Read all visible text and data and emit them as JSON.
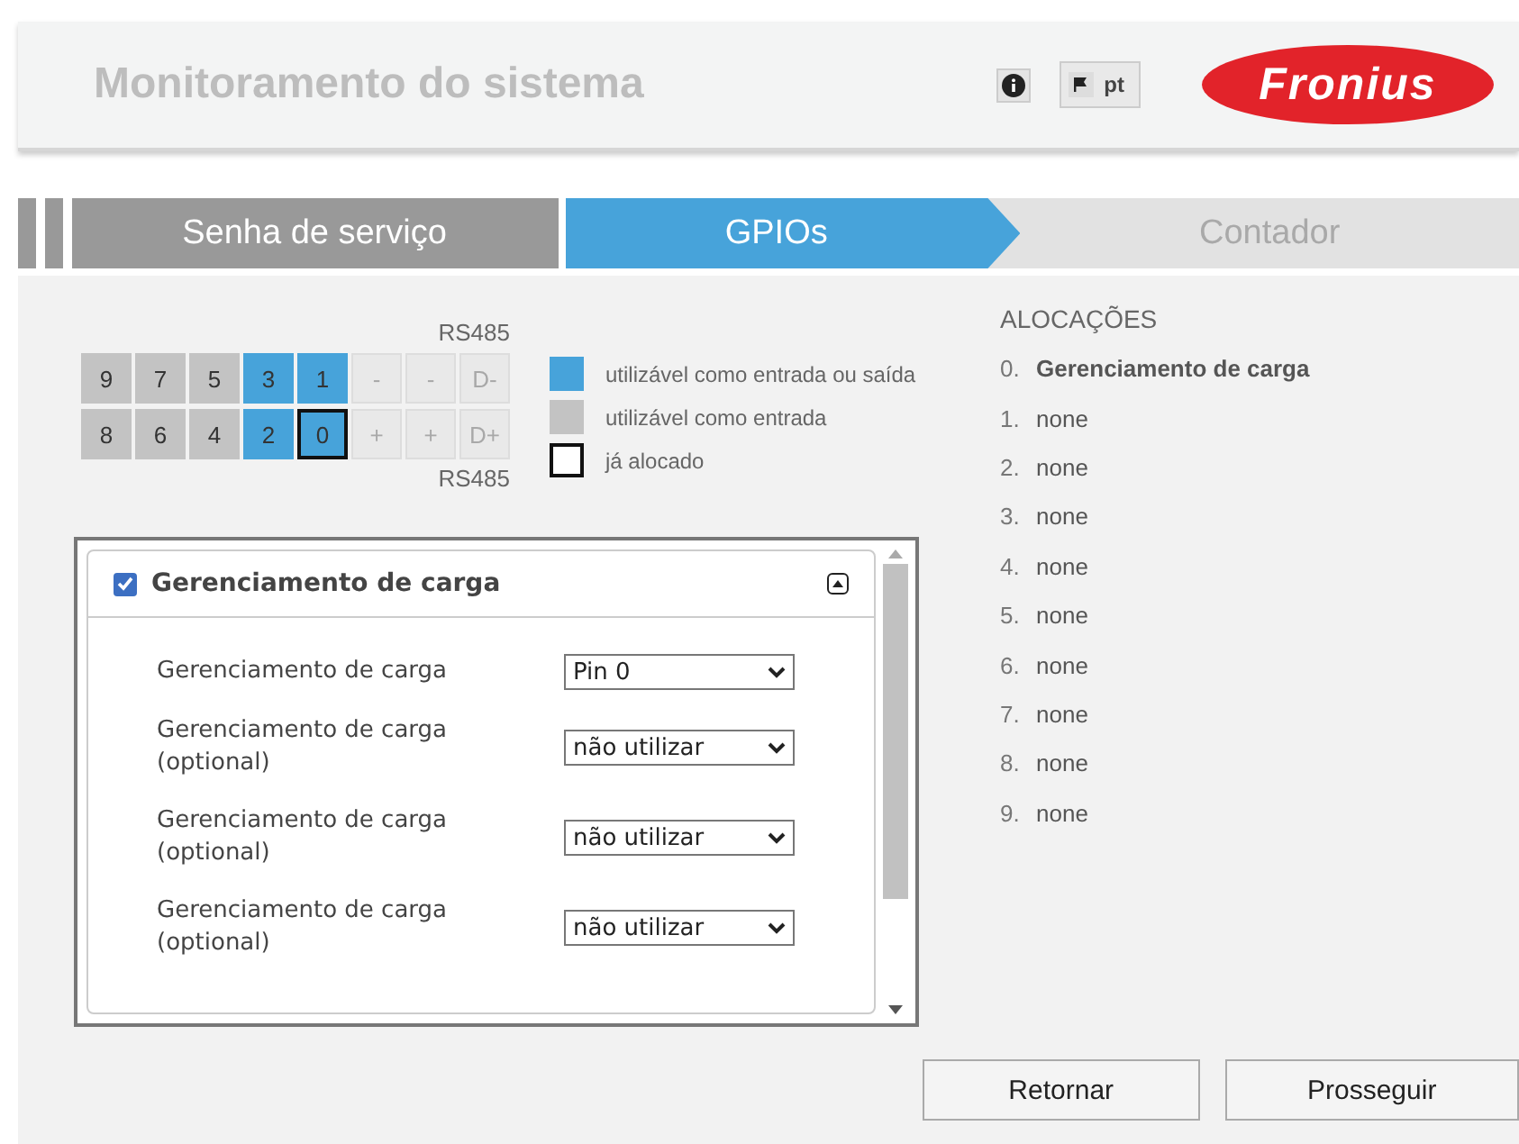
{
  "header": {
    "title": "Monitoramento do sistema",
    "language": "pt",
    "logo": "Fronius"
  },
  "steps": [
    {
      "label": "Senha de serviço",
      "completed": true,
      "selected": false
    },
    {
      "label": "GPIOs",
      "completed": false,
      "selected": true
    },
    {
      "label": "Contador",
      "completed": false,
      "selected": false
    }
  ],
  "pins": {
    "top_label": "RS485",
    "bottom_label": "RS485",
    "rows": [
      [
        {
          "label": "9",
          "kind": "input",
          "allocated": false
        },
        {
          "label": "7",
          "kind": "input",
          "allocated": false
        },
        {
          "label": "5",
          "kind": "input",
          "allocated": false
        },
        {
          "label": "3",
          "kind": "io",
          "allocated": false
        },
        {
          "label": "1",
          "kind": "io",
          "allocated": false
        },
        {
          "label": "-",
          "kind": "unavailable",
          "allocated": false
        },
        {
          "label": "-",
          "kind": "unavailable",
          "allocated": false
        },
        {
          "label": "D-",
          "kind": "unavailable",
          "allocated": false
        }
      ],
      [
        {
          "label": "8",
          "kind": "input",
          "allocated": false
        },
        {
          "label": "6",
          "kind": "input",
          "allocated": false
        },
        {
          "label": "4",
          "kind": "input",
          "allocated": false
        },
        {
          "label": "2",
          "kind": "io",
          "allocated": false
        },
        {
          "label": "0",
          "kind": "io",
          "allocated": true
        },
        {
          "label": "+",
          "kind": "unavailable",
          "allocated": false
        },
        {
          "label": "+",
          "kind": "unavailable",
          "allocated": false
        },
        {
          "label": "D+",
          "kind": "unavailable",
          "allocated": false
        }
      ]
    ]
  },
  "legend": [
    {
      "kind": "io",
      "label": "utilizável como entrada ou saída"
    },
    {
      "kind": "input",
      "label": "utilizável como entrada"
    },
    {
      "kind": "allocated",
      "label": "já alocado"
    }
  ],
  "allocations": {
    "title": "ALOCAÇÕES",
    "items": [
      {
        "number": "0.",
        "label": "Gerenciamento de carga",
        "assigned": true
      },
      {
        "number": "1.",
        "label": "none",
        "assigned": false
      },
      {
        "number": "2.",
        "label": "none",
        "assigned": false
      },
      {
        "number": "3.",
        "label": "none",
        "assigned": false
      },
      {
        "number": "4.",
        "label": "none",
        "assigned": false
      },
      {
        "number": "5.",
        "label": "none",
        "assigned": false
      },
      {
        "number": "6.",
        "label": "none",
        "assigned": false
      },
      {
        "number": "7.",
        "label": "none",
        "assigned": false
      },
      {
        "number": "8.",
        "label": "none",
        "assigned": false
      },
      {
        "number": "9.",
        "label": "none",
        "assigned": false
      }
    ]
  },
  "panel": {
    "title": "Gerenciamento de carga",
    "checked": true,
    "expanded": true,
    "rows": [
      {
        "label": "Gerenciamento de carga",
        "value": "Pin 0"
      },
      {
        "label": "Gerenciamento de carga (optional)",
        "value": "não utilizar"
      },
      {
        "label": "Gerenciamento de carga (optional)",
        "value": "não utilizar"
      },
      {
        "label": "Gerenciamento de carga (optional)",
        "value": "não utilizar"
      }
    ]
  },
  "buttons": [
    "Retornar",
    "Prosseguir"
  ]
}
